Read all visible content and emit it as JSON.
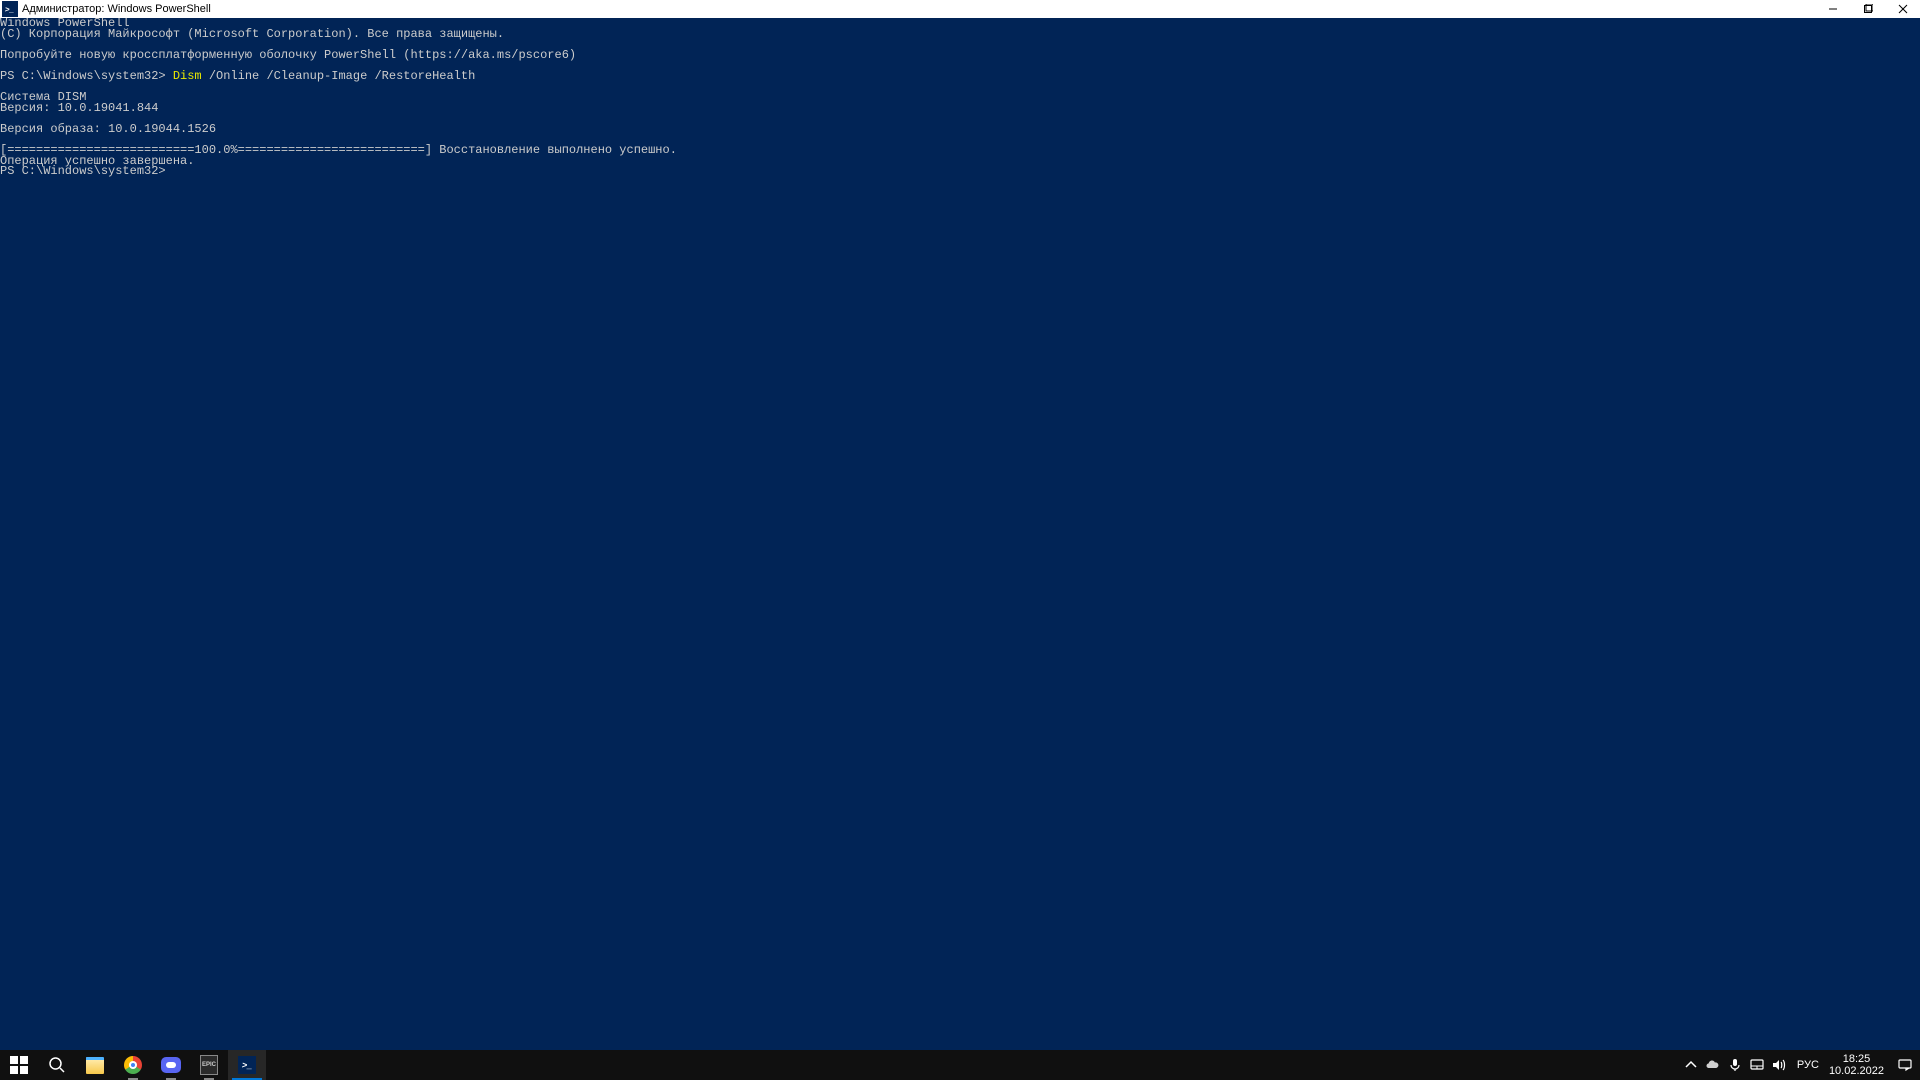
{
  "window": {
    "title": "Администратор: Windows PowerShell"
  },
  "terminal": {
    "header1": "Windows PowerShell",
    "header2": "(C) Корпорация Майкрософт (Microsoft Corporation). Все права защищены.",
    "try_line": "Попробуйте новую кроссплатформенную оболочку PowerShell (https://aka.ms/pscore6)",
    "prompt1": "PS C:\\Windows\\system32> ",
    "cmd_name": "Dism",
    "cmd_args": " /Online /Cleanup-Image /RestoreHealth",
    "dism_system": "Cистема DISM",
    "dism_version": "Версия: 10.0.19041.844",
    "image_version": "Версия образа: 10.0.19044.1526",
    "progress": "[==========================100.0%==========================] Восстановление выполнено успешно.",
    "op_done": "Операция успешно завершена.",
    "prompt2": "PS C:\\Windows\\system32> "
  },
  "taskbar": {
    "lang": "РУС",
    "time": "18:25",
    "date": "10.02.2022"
  }
}
